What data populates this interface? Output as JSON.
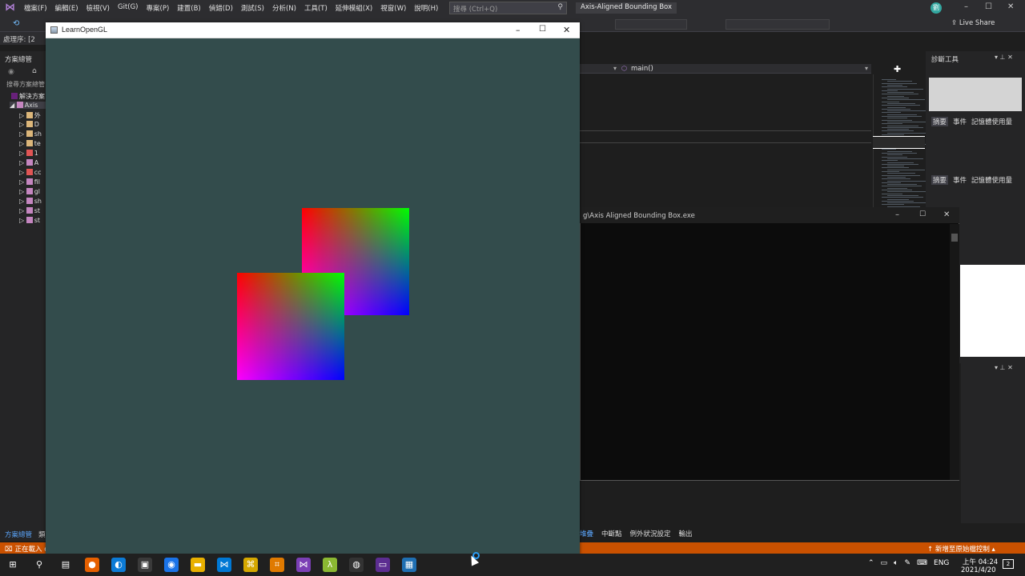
{
  "vs": {
    "menus": [
      "檔案(F)",
      "編輯(E)",
      "檢視(V)",
      "Git(G)",
      "專案(P)",
      "建置(B)",
      "偵錯(D)",
      "測試(S)",
      "分析(N)",
      "工具(T)",
      "延伸模組(X)",
      "視窗(W)",
      "說明(H)"
    ],
    "search_placeholder": "搜尋 (Ctrl+Q)",
    "window_title": "Axis-Aligned Bounding Box",
    "user_initial": "劉",
    "live_share": "Live Share",
    "process_label": "處理序:",
    "process_value": "[2",
    "solution_explorer_title": "方案總管",
    "solution_search": "搜尋方案總管",
    "solution_label": "解決方案",
    "project_label": "Axis",
    "tree": [
      "外",
      "D",
      "sh",
      "te",
      "1",
      "A",
      "cc",
      "fil",
      "gl",
      "sh",
      "st",
      "st"
    ],
    "solution_tab": "方案總管",
    "solution_tab2": "類",
    "func_combo": "main()",
    "diag_title": "診斷工具",
    "diag_tabs": [
      "摘要",
      "事件",
      "記憶體使用量"
    ],
    "console_title": "g\\Axis Aligned Bounding Box.exe",
    "bottom_tabs": [
      "堆疊",
      "中斷點",
      "例外狀況設定",
      "輸出"
    ],
    "status_left": "正在載入 c",
    "status_right": "新增至原始檔控制"
  },
  "gl": {
    "title": "LearnOpenGL",
    "clear_color": "#334c4c"
  },
  "taskbar": {
    "icons": [
      "windows-start",
      "search",
      "task-view",
      "firefox",
      "edge",
      "store",
      "chrome",
      "file-explorer",
      "vscode",
      "app-yellow",
      "app-orange",
      "visual-studio",
      "app-green",
      "obs",
      "app-purple",
      "learnopengl"
    ],
    "tray_lang": "ENG",
    "time": "上午 04:24",
    "date": "2021/4/20",
    "notifications": "2"
  }
}
